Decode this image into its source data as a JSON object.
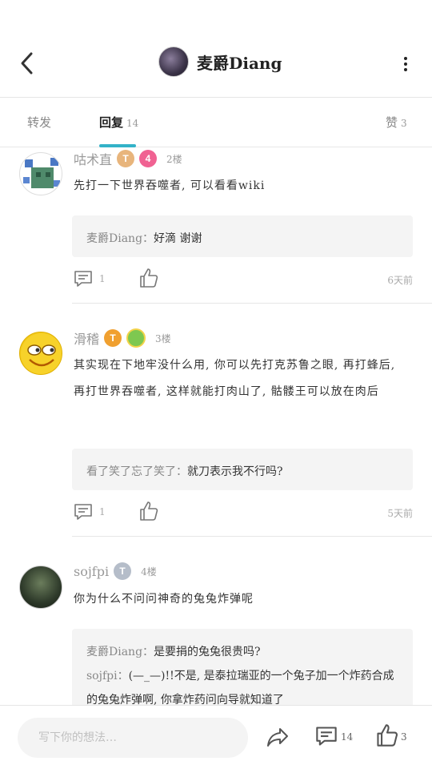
{
  "header": {
    "title": "麦爵Diang",
    "back_icon": "chevron-left-icon",
    "more_icon": "more-vertical-icon"
  },
  "tabs": [
    {
      "label": "转发",
      "count": ""
    },
    {
      "label": "回复",
      "count": "14"
    },
    {
      "label": "赞",
      "count": "3"
    }
  ],
  "accent": "#33b2c8",
  "posts": [
    {
      "name": "咕术直",
      "badge": "T",
      "level": "4",
      "floor": "2楼",
      "text": "先打一下世界吞噬者, 可以看看wiki",
      "quotes": [
        {
          "name": "麦爵Diang：",
          "text": "好滴 谢谢"
        }
      ],
      "comments": "1",
      "time": "6天前"
    },
    {
      "name": "滑稽",
      "badge": "T",
      "floor": "3楼",
      "text": "其实现在下地牢没什么用, 你可以先打克苏鲁之眼, 再打蜂后, 再打世界吞噬者, 这样就能打肉山了, 骷髅王可以放在肉后",
      "quotes": [
        {
          "name": "看了笑了忘了笑了：",
          "text": "就刀表示我不行吗?"
        }
      ],
      "comments": "1",
      "time": "5天前"
    },
    {
      "name": "sojfpi",
      "badge": "T",
      "floor": "4楼",
      "text": "你为什么不问问神奇的兔兔炸弹呢",
      "quotes": [
        {
          "name": "麦爵Diang：",
          "text": "是要捐的兔兔很贵吗?"
        },
        {
          "name": "sojfpi：",
          "text": "(—_—)!!不是, 是泰拉瑞亚的一个兔子加一个炸药合成的兔兔炸弹啊, 你拿炸药问向导就知道了"
        }
      ]
    }
  ],
  "bottom": {
    "placeholder": "写下你的想法…",
    "comment_count": "14",
    "like_count": "3"
  }
}
